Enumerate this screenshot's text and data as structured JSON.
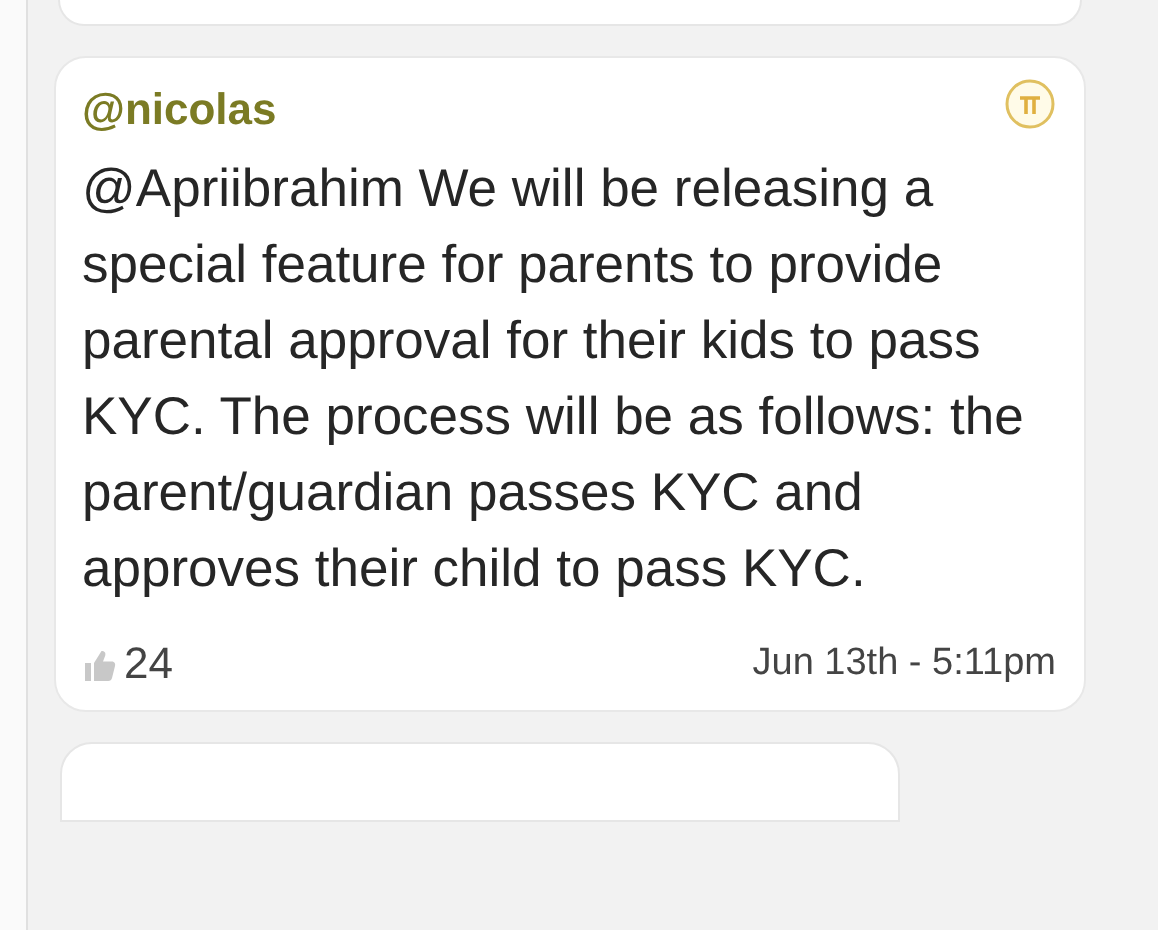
{
  "post": {
    "author": "@nicolas",
    "text": "@Apriibrahim We will be releasing a special feature for parents to provide parental approval for their kids to pass KYC. The process will be as follows: the parent/guardian passes KYC and approves their child to pass KYC.",
    "likes": "24",
    "time": "Jun 13th - 5:11pm"
  }
}
